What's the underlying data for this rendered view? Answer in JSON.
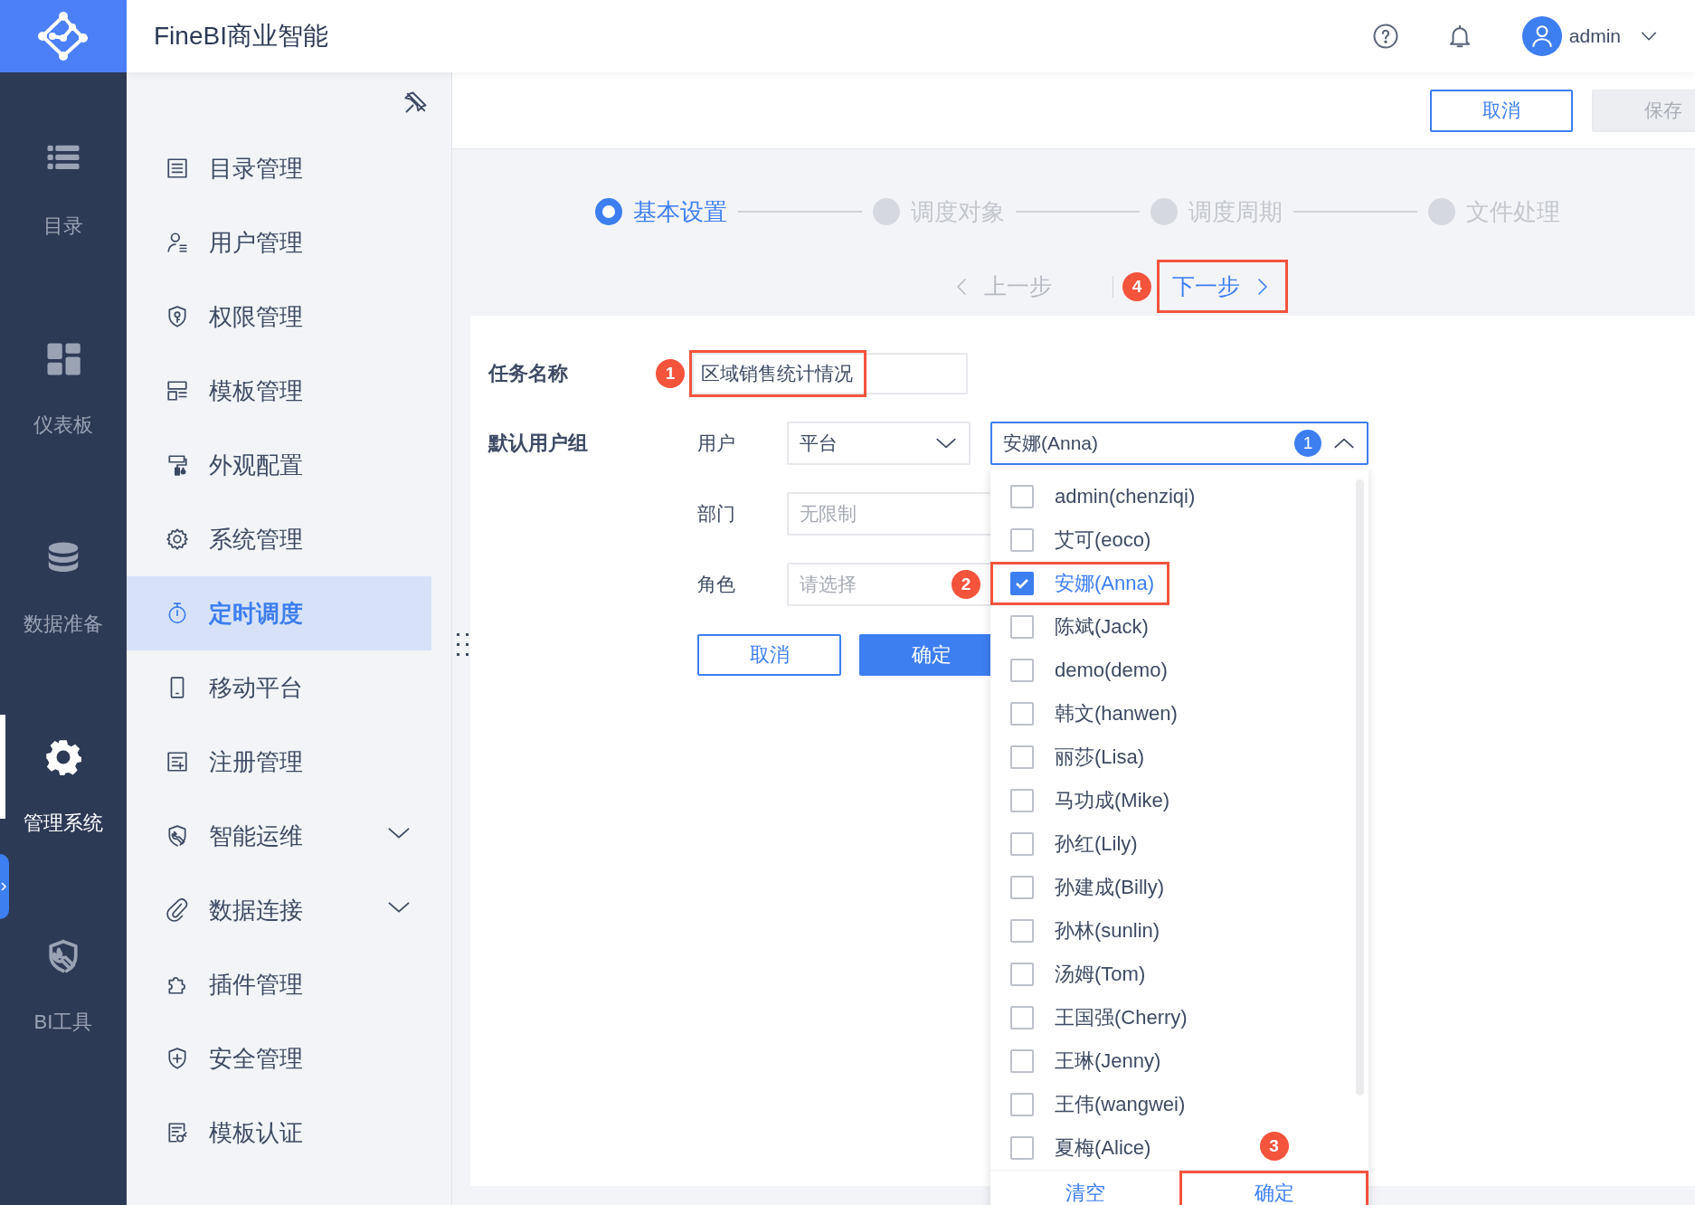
{
  "app": {
    "title": "FineBI商业智能"
  },
  "rail": [
    {
      "label": "目录",
      "selected": false
    },
    {
      "label": "仪表板",
      "selected": false
    },
    {
      "label": "数据准备",
      "selected": false
    },
    {
      "label": "管理系统",
      "selected": true
    },
    {
      "label": "BI工具",
      "selected": false
    }
  ],
  "header": {
    "user": "admin"
  },
  "menu": [
    {
      "label": "目录管理",
      "selected": false,
      "expandable": false
    },
    {
      "label": "用户管理",
      "selected": false,
      "expandable": false
    },
    {
      "label": "权限管理",
      "selected": false,
      "expandable": false
    },
    {
      "label": "模板管理",
      "selected": false,
      "expandable": false
    },
    {
      "label": "外观配置",
      "selected": false,
      "expandable": false
    },
    {
      "label": "系统管理",
      "selected": false,
      "expandable": false
    },
    {
      "label": "定时调度",
      "selected": true,
      "expandable": false
    },
    {
      "label": "移动平台",
      "selected": false,
      "expandable": false
    },
    {
      "label": "注册管理",
      "selected": false,
      "expandable": false
    },
    {
      "label": "智能运维",
      "selected": false,
      "expandable": true
    },
    {
      "label": "数据连接",
      "selected": false,
      "expandable": true
    },
    {
      "label": "插件管理",
      "selected": false,
      "expandable": false
    },
    {
      "label": "安全管理",
      "selected": false,
      "expandable": false
    },
    {
      "label": "模板认证",
      "selected": false,
      "expandable": false
    }
  ],
  "toolbar": [
    {
      "label": "取消",
      "disabled": false
    },
    {
      "label": "保存",
      "disabled": true
    }
  ],
  "steps": [
    {
      "label": "基本设置",
      "selected": true
    },
    {
      "label": "调度对象",
      "selected": false
    },
    {
      "label": "调度周期",
      "selected": false
    },
    {
      "label": "文件处理",
      "selected": false
    }
  ],
  "step_nav": {
    "prev": {
      "label": "上一步",
      "disabled": true
    },
    "next": {
      "label": "下一步",
      "disabled": false,
      "highlighted": true,
      "callout": "4"
    }
  },
  "form": {
    "task_name": {
      "label": "任务名称",
      "value": "区域销售统计情况",
      "highlighted": true,
      "callout": "1"
    },
    "group": {
      "label": "默认用户组",
      "fields": [
        {
          "label": "用户",
          "kind": "select",
          "value": "平台"
        },
        {
          "label": "部门",
          "kind": "input",
          "placeholder": "无限制"
        },
        {
          "label": "角色",
          "kind": "input",
          "placeholder": "请选择"
        }
      ]
    },
    "buttons": [
      {
        "label": "取消",
        "kind": "outline"
      },
      {
        "label": "确定",
        "kind": "primary"
      }
    ]
  },
  "user_picker": {
    "value": "安娜(Anna)",
    "count": "1",
    "expanded": true,
    "options": [
      {
        "label": "admin(chenziqi)",
        "checked": false,
        "highlighted": false
      },
      {
        "label": "艾可(eoco)",
        "checked": false,
        "highlighted": false
      },
      {
        "label": "安娜(Anna)",
        "checked": true,
        "highlighted": true,
        "callout": "2"
      },
      {
        "label": "陈斌(Jack)",
        "checked": false,
        "highlighted": false
      },
      {
        "label": "demo(demo)",
        "checked": false,
        "highlighted": false
      },
      {
        "label": "韩文(hanwen)",
        "checked": false,
        "highlighted": false
      },
      {
        "label": "丽莎(Lisa)",
        "checked": false,
        "highlighted": false
      },
      {
        "label": "马功成(Mike)",
        "checked": false,
        "highlighted": false
      },
      {
        "label": "孙红(Lily)",
        "checked": false,
        "highlighted": false
      },
      {
        "label": "孙建成(Billy)",
        "checked": false,
        "highlighted": false
      },
      {
        "label": "孙林(sunlin)",
        "checked": false,
        "highlighted": false
      },
      {
        "label": "汤姆(Tom)",
        "checked": false,
        "highlighted": false
      },
      {
        "label": "王国强(Cherry)",
        "checked": false,
        "highlighted": false
      },
      {
        "label": "王琳(Jenny)",
        "checked": false,
        "highlighted": false
      },
      {
        "label": "王伟(wangwei)",
        "checked": false,
        "highlighted": false
      },
      {
        "label": "夏梅(Alice)",
        "checked": false,
        "highlighted": false
      }
    ],
    "footer": [
      {
        "label": "清空",
        "highlighted": false
      },
      {
        "label": "确定",
        "highlighted": true,
        "callout": "3"
      }
    ]
  }
}
